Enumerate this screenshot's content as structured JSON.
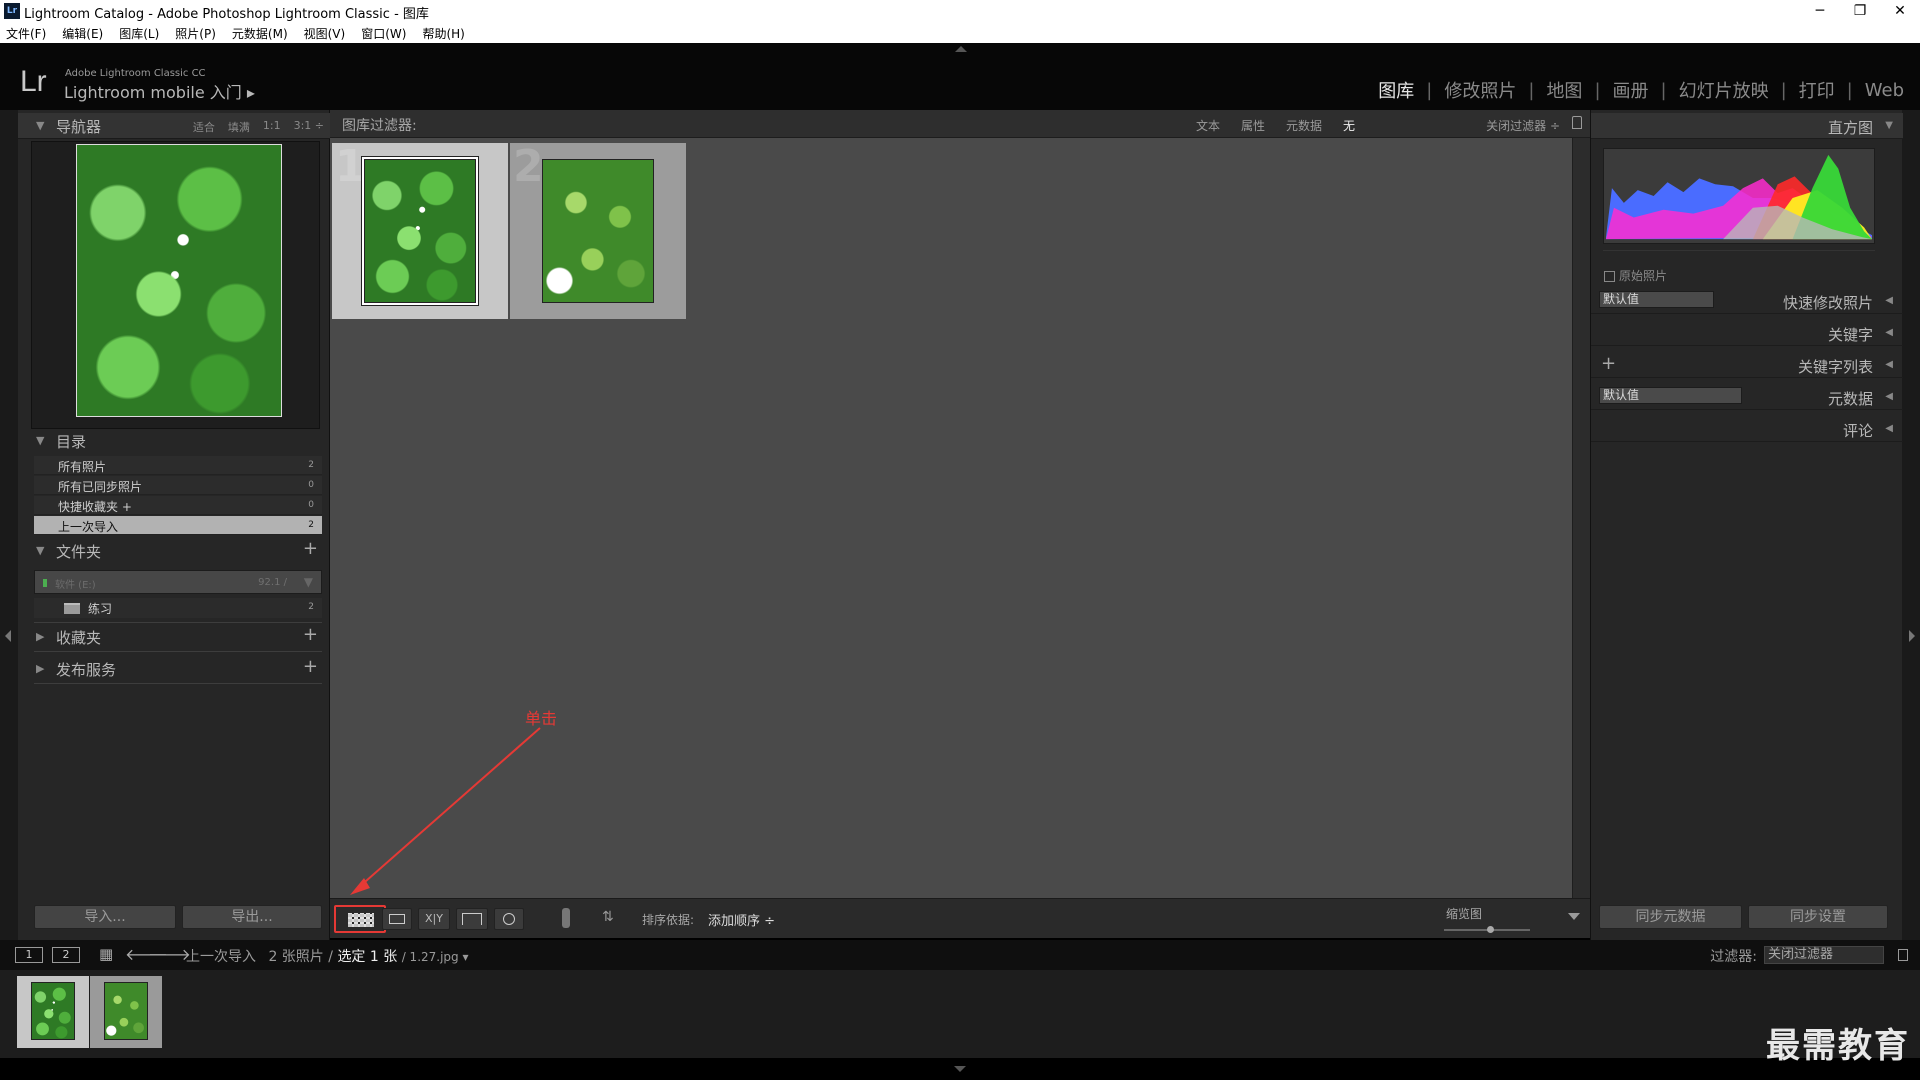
{
  "window": {
    "title": "Lightroom Catalog - Adobe Photoshop Lightroom Classic - 图库",
    "app_icon": "Lr",
    "min": "─",
    "restore": "❐",
    "close": "✕"
  },
  "menu": [
    "文件(F)",
    "编辑(E)",
    "图库(L)",
    "照片(P)",
    "元数据(M)",
    "视图(V)",
    "窗口(W)",
    "帮助(H)"
  ],
  "identity": {
    "logo": "Lr",
    "version": "Adobe Lightroom Classic CC",
    "mobile": "Lightroom mobile 入门 ▸"
  },
  "modules": [
    {
      "label": "图库",
      "active": true
    },
    {
      "label": "修改照片"
    },
    {
      "label": "地图"
    },
    {
      "label": "画册"
    },
    {
      "label": "幻灯片放映"
    },
    {
      "label": "打印"
    },
    {
      "label": "Web"
    }
  ],
  "left": {
    "navigator": {
      "title": "导航器",
      "opts": [
        "适合",
        "填满",
        "1:1",
        "3:1 ÷"
      ]
    },
    "catalog": {
      "title": "目录",
      "items": [
        {
          "label": "所有照片",
          "count": "2"
        },
        {
          "label": "所有已同步照片",
          "count": "0"
        },
        {
          "label": "快捷收藏夹 +",
          "count": "0"
        },
        {
          "label": "上一次导入",
          "count": "2",
          "selected": true
        }
      ]
    },
    "folders": {
      "title": "文件夹",
      "volume": {
        "name": "软件 (E:)",
        "size": "92.1 /"
      },
      "folder": {
        "label": "练习",
        "count": "2"
      }
    },
    "collections": {
      "title": "收藏夹"
    },
    "publish": {
      "title": "发布服务"
    },
    "import_btn": "导入...",
    "export_btn": "导出..."
  },
  "filter": {
    "title": "图库过滤器:",
    "options": [
      {
        "label": "文本"
      },
      {
        "label": "属性"
      },
      {
        "label": "元数据"
      },
      {
        "label": "无",
        "active": true
      }
    ],
    "close": "关闭过滤器 ÷"
  },
  "grid": [
    {
      "index": "1",
      "selected": true
    },
    {
      "index": "2",
      "selected": false
    }
  ],
  "toolbar": {
    "sort_label": "排序依据:",
    "sort_value": "添加顺序 ÷",
    "zoom_label": "缩览图"
  },
  "right": {
    "histogram": {
      "title": "直方图",
      "original": "原始照片"
    },
    "quick_develop": {
      "title": "快速修改照片",
      "preset": "默认值"
    },
    "keywording": {
      "title": "关键字"
    },
    "keyword_list": {
      "title": "关键字列表"
    },
    "metadata": {
      "title": "元数据",
      "preset": "默认值"
    },
    "comments": {
      "title": "评论"
    },
    "sync_metadata": "同步元数据",
    "sync_settings": "同步设置"
  },
  "filmstrip": {
    "screen1": "1",
    "screen2": "2",
    "source": "上一次导入",
    "count_text": "2 张照片 /",
    "selected_text": "选定 1 张",
    "file_text": "/ 1.27.jpg ▾",
    "filter_label": "过滤器:",
    "filter_value": "关闭过滤器"
  },
  "annotation": {
    "text": "单击",
    "color": "#e53935"
  },
  "watermark": "最需教育",
  "colors": {
    "accent_red": "#e53935",
    "selection": "#c7c7c7",
    "grid_bg": "#4a4a4a"
  }
}
